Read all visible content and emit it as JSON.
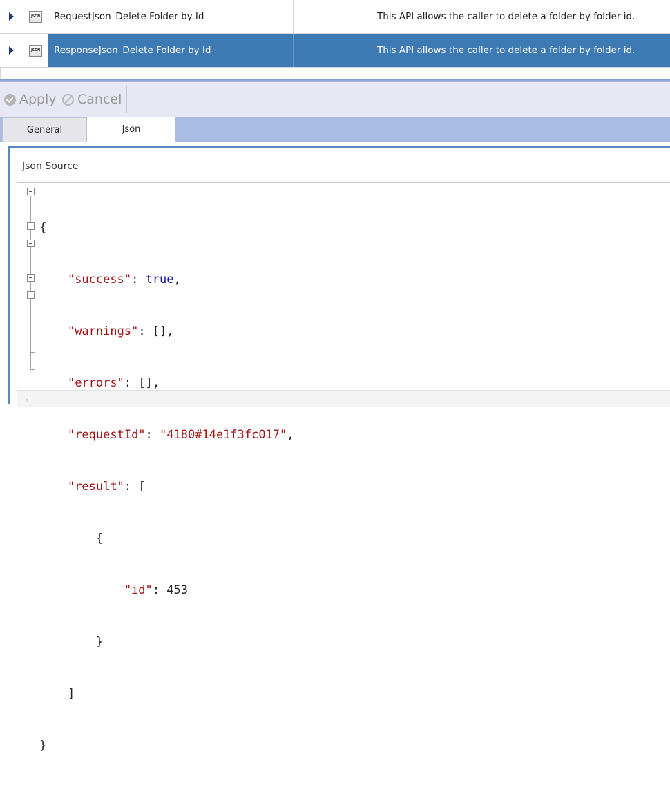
{
  "grid": {
    "rows": [
      {
        "icon_text": "JSON",
        "name": "RequestJson_Delete Folder by Id",
        "extra1": "",
        "extra2": "",
        "description": "This API allows the caller to delete a folder by folder id.",
        "selected": false
      },
      {
        "icon_text": "JSON",
        "name": "ResponseJson_Delete Folder by Id",
        "extra1": "",
        "extra2": "",
        "description": "This API allows the caller to delete a folder by folder id.",
        "selected": true
      }
    ]
  },
  "toolbar": {
    "apply_label": "Apply",
    "cancel_label": "Cancel"
  },
  "tabs": [
    {
      "label": "General",
      "active": false
    },
    {
      "label": "Json",
      "active": true
    }
  ],
  "json_panel": {
    "title": "Json Source",
    "lines": [
      "{",
      "    \"success\": true,",
      "    \"warnings\": [],",
      "    \"errors\": [],",
      "    \"requestId\": \"4180#14e1f3fc017\",",
      "    \"result\": [",
      "        {",
      "            \"id\": 453",
      "        }",
      "    ]",
      "}"
    ]
  },
  "colors": {
    "selection": "#3d7ab3",
    "tabbar": "#a9bde3",
    "panel_border": "#5b86c4",
    "json_key": "#a31515",
    "json_bool": "#1a1aa6"
  }
}
